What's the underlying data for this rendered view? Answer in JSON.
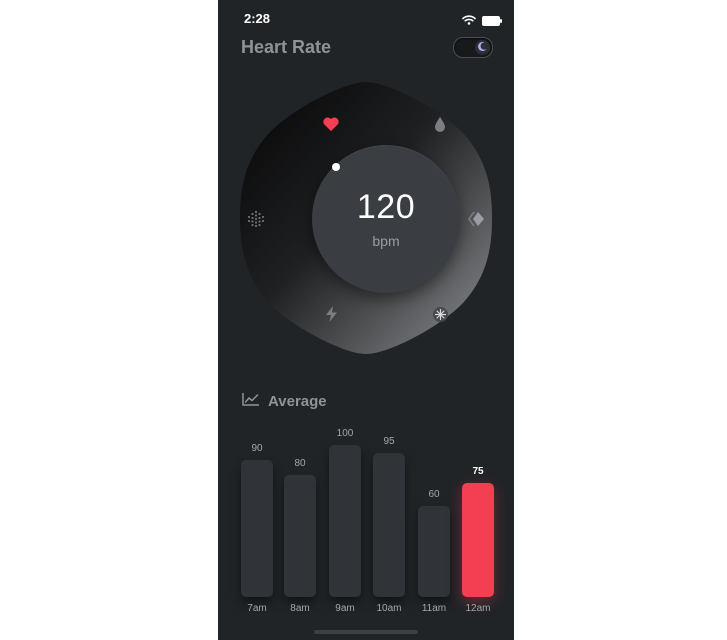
{
  "status": {
    "time": "2:28",
    "wifi_icon": "wifi-icon",
    "battery_icon": "battery-icon"
  },
  "header": {
    "title": "Heart Rate",
    "theme_toggle_icon": "moon-icon",
    "theme_toggle_state": "dark"
  },
  "dial": {
    "value": "120",
    "unit": "bpm",
    "icons": [
      "heart-icon",
      "water-drop-icon",
      "diamond-icon",
      "compass-icon",
      "lightning-icon",
      "dots-grid-icon"
    ],
    "active_icon": "heart-icon"
  },
  "average": {
    "label": "Average",
    "icon": "line-chart-icon"
  },
  "chart_data": {
    "type": "bar",
    "title": "Average",
    "categories": [
      "7am",
      "8am",
      "9am",
      "10am",
      "11am",
      "12am"
    ],
    "values": [
      90,
      80,
      100,
      95,
      60,
      75
    ],
    "value_labels": [
      "90",
      "80",
      "100",
      "95",
      "60",
      "75"
    ],
    "highlighted_index": 5,
    "highlight_color": "#f43f52",
    "bar_color": "#303337",
    "ylim": [
      0,
      100
    ]
  },
  "colors": {
    "background": "#212427",
    "accent": "#f43f52",
    "text_muted": "#8f9398"
  }
}
